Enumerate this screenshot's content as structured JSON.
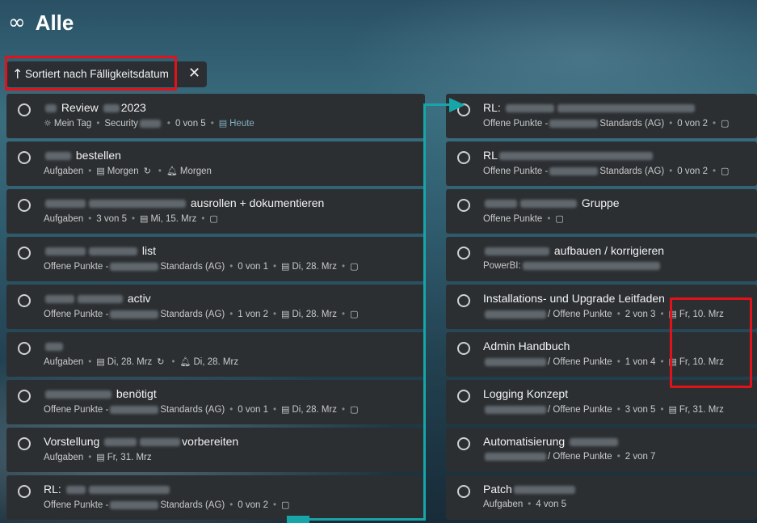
{
  "header": {
    "icon": "infinity-icon",
    "title": "Alle"
  },
  "sort": {
    "label": "Sortiert nach Fälligkeitsdatum"
  },
  "colors": {
    "accent_red": "#e0121a",
    "teal": "#18a5a9"
  },
  "left_tasks": [
    {
      "t1": "Review",
      "t2": "2023",
      "l1": "Mein Tag",
      "l2": "Security",
      "l3": "0 von 5",
      "l4": "Heute"
    },
    {
      "t1": "bestellen",
      "l1": "Aufgaben",
      "l2": "Morgen",
      "l3": "Morgen"
    },
    {
      "t1": "ausrollen + dokumentieren",
      "l1": "Aufgaben",
      "l2": "3 von 5",
      "l3": "Mi, 15. Mrz"
    },
    {
      "t1": "list",
      "l1": "Offene Punkte -",
      "l2": "Standards (AG)",
      "l3": "0 von 1",
      "l4": "Di, 28. Mrz"
    },
    {
      "t1": "activ",
      "l1": "Offene Punkte -",
      "l2": "Standards (AG)",
      "l3": "1 von 2",
      "l4": "Di, 28. Mrz"
    },
    {
      "l1": "Aufgaben",
      "l2": "Di, 28. Mrz",
      "l3": "Di, 28. Mrz"
    },
    {
      "t1": "benötigt",
      "l1": "Offene Punkte -",
      "l2": "Standards (AG)",
      "l3": "0 von 1",
      "l4": "Di, 28. Mrz"
    },
    {
      "t1": "Vorstellung",
      "t2": "vorbereiten",
      "l1": "Aufgaben",
      "l2": "Fr, 31. Mrz"
    },
    {
      "t1": "RL:",
      "l1": "Offene Punkte -",
      "l2": "Standards (AG)",
      "l3": "0 von 2"
    }
  ],
  "right_tasks": [
    {
      "t1": "RL:",
      "l1": "Offene Punkte -",
      "l2": "Standards (AG)",
      "l3": "0 von 2"
    },
    {
      "t1": "RL",
      "l1": "Offene Punkte -",
      "l2": "Standards (AG)",
      "l3": "0 von 2"
    },
    {
      "t1": "Gruppe",
      "l1": "Offene Punkte"
    },
    {
      "t1": "aufbauen / korrigieren",
      "l1": "PowerBI:"
    },
    {
      "t1": "Installations- und Upgrade Leitfaden",
      "l1": "/ Offene Punkte",
      "l2": "2 von 3",
      "l3": "Fr, 10. Mrz"
    },
    {
      "t1": "Admin Handbuch",
      "l1": "/ Offene Punkte",
      "l2": "1 von 4",
      "l3": "Fr, 10. Mrz"
    },
    {
      "t1": "Logging Konzept",
      "l1": "/ Offene Punkte",
      "l2": "3 von 5",
      "l3": "Fr, 31. Mrz"
    },
    {
      "t1": "Automatisierung",
      "l1": "/ Offene Punkte",
      "l2": "2 von 7"
    },
    {
      "t1": "Patch",
      "l1": "Aufgaben",
      "l2": "4 von 5"
    }
  ]
}
